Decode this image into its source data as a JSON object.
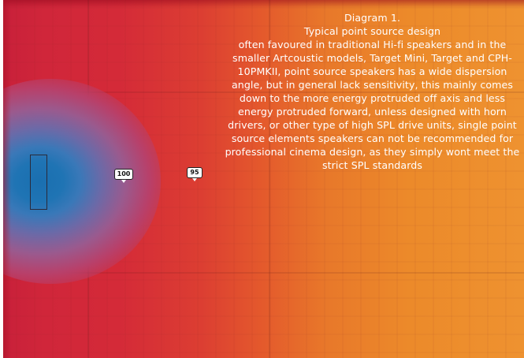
{
  "diagram": {
    "caption_title": "Diagram 1.",
    "caption_subtitle": "Typical point source design",
    "caption_body": "often favoured in traditional Hi-fi speakers and in the smaller Artcoustic models, Target Mini, Target and CPH-10PMKII, point source speakers has a wide dispersion angle, but in general lack sensitivity, this mainly comes down to the more energy protruded off axis and less energy protruded forward, unless designed with horn drivers, or other type of high SPL drive units, single point source elements speakers can not be recommended for professional cinema design, as they simply wont meet the strict SPL standards",
    "markers": [
      {
        "label": "100"
      },
      {
        "label": "95"
      }
    ],
    "colors": {
      "hot": "#c8203a",
      "warm": "#ee9230",
      "core": "#1a6fb0",
      "grid": "#8a2a2a"
    }
  }
}
